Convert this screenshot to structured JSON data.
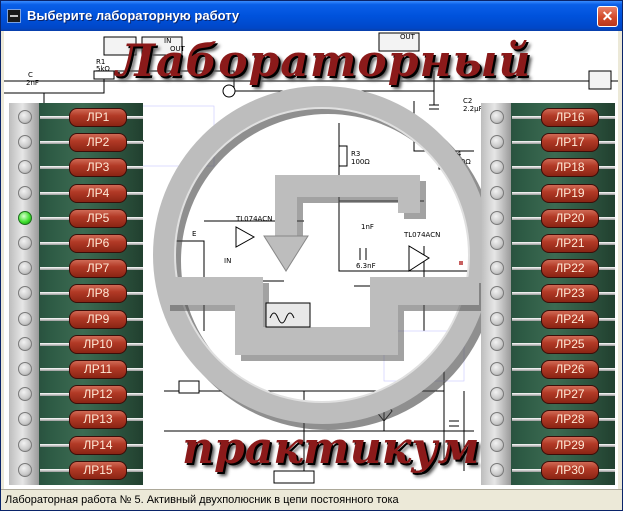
{
  "window": {
    "title": "Выберите лабораторную работу",
    "close_label": "✕"
  },
  "logo": {
    "line1": "Лабораторный",
    "line2": "практикум",
    "colors": {
      "text": "#8B1A1A",
      "ring": "#BDBDBD"
    }
  },
  "schematic_labels": {
    "c_top": "C",
    "c_top_value": "2nF",
    "r1": "R1",
    "r1_value": "5kΩ",
    "c2": "C2",
    "c2_value": "2.2μF",
    "r3": "R3",
    "r3_value": "100Ω",
    "r4": "R4",
    "r4_value": "800Ω",
    "opamp1": "TL074ACN",
    "opamp2": "TL074ACN",
    "c_mid": "1nF",
    "c_mid2": "6.3nF",
    "label_e": "E",
    "label_in": "IN",
    "scope_in": "IN",
    "scope_out": "OUT",
    "scope_small": "OUT"
  },
  "lab_buttons_left": [
    "ЛР1",
    "ЛР2",
    "ЛР3",
    "ЛР4",
    "ЛР5",
    "ЛР6",
    "ЛР7",
    "ЛР8",
    "ЛР9",
    "ЛР10",
    "ЛР11",
    "ЛР12",
    "ЛР13",
    "ЛР14",
    "ЛР15"
  ],
  "lab_buttons_right": [
    "ЛР16",
    "ЛР17",
    "ЛР18",
    "ЛР19",
    "ЛР20",
    "ЛР21",
    "ЛР22",
    "ЛР23",
    "ЛР24",
    "ЛР25",
    "ЛР26",
    "ЛР27",
    "ЛР28",
    "ЛР29",
    "ЛР30"
  ],
  "active_lab_index": 4,
  "status": {
    "text": "Лабораторная работа № 5. Активный двухполюсник в цепи постоянного тока"
  }
}
